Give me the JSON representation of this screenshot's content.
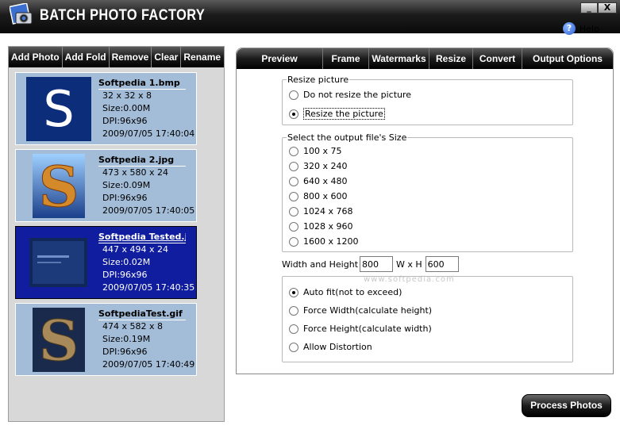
{
  "window": {
    "title": "BATCH PHOTO FACTORY",
    "minimize": "_",
    "close": "X"
  },
  "help": {
    "label": "Help"
  },
  "left_toolbar": [
    "Add Photo",
    "Add Fold",
    "Remove",
    "Clear",
    "Rename"
  ],
  "photos": [
    {
      "name": "Softpedia 1.bmp",
      "dims": "32 x 32 x 8",
      "size": "Size:0.00M",
      "dpi": "DPI:96x96",
      "date": "2009/07/05 17:40:04",
      "selected": false
    },
    {
      "name": "Softpedia 2.jpg",
      "dims": "473 x 580 x 24",
      "size": "Size:0.09M",
      "dpi": "DPI:96x96",
      "date": "2009/07/05 17:40:05",
      "selected": false
    },
    {
      "name": "Softpedia Tested.jp",
      "dims": "447 x 494 x 24",
      "size": "Size:0.02M",
      "dpi": "DPI:96x96",
      "date": "2009/07/05 17:40:35",
      "selected": true
    },
    {
      "name": "SoftpediaTest.gif",
      "dims": "474 x 582 x 8",
      "size": "Size:0.19M",
      "dpi": "DPI:96x96",
      "date": "2009/07/05 17:40:49",
      "selected": false
    }
  ],
  "tabs": [
    "Preview",
    "Frame",
    "Watermarks",
    "Resize",
    "Convert",
    "Output Options"
  ],
  "resize_picture": {
    "legend": "Resize picture",
    "options": [
      "Do not resize the picture",
      "Resize the picture"
    ],
    "selected": 1
  },
  "output_size": {
    "legend": "Select the output file's Size",
    "options": [
      "100 x 75",
      "320 x 240",
      "640 x 480",
      "800 x 600",
      "1024 x 768",
      "1028 x 960",
      "1600 x 1200"
    ]
  },
  "width_height": {
    "label": "Width and Height",
    "width": "800",
    "separator": "W x H",
    "height": "600"
  },
  "fit_mode": {
    "options": [
      "Auto fit(not to exceed)",
      "Force Width(calculate height)",
      "Force Height(calculate width)",
      "Allow Distortion"
    ],
    "selected": 0
  },
  "watermark": "www.softpedia.com",
  "process_button": "Process Photos"
}
